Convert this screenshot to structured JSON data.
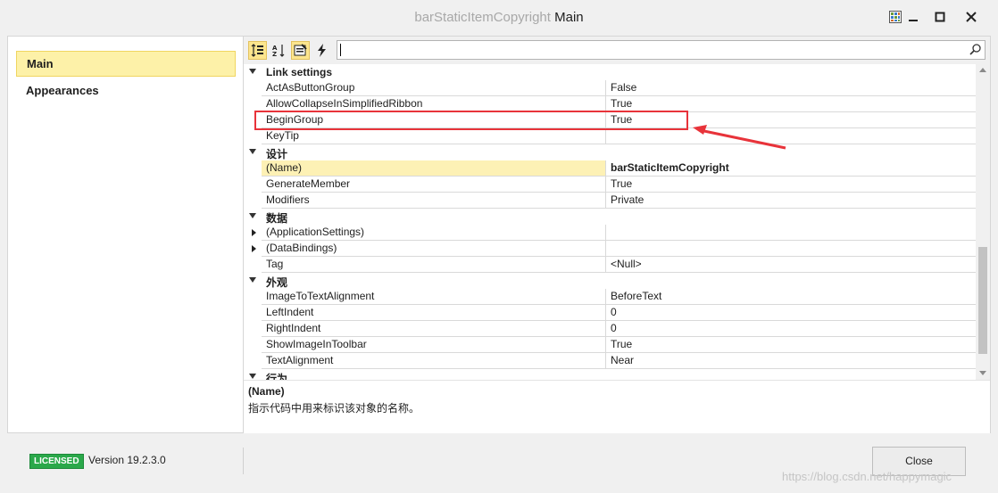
{
  "window": {
    "title_dim": "barStaticItemCopyright",
    "title_active": "Main"
  },
  "sidebar": {
    "items": [
      {
        "label": "Main",
        "selected": true
      },
      {
        "label": "Appearances",
        "selected": false
      }
    ]
  },
  "search": {
    "value": "",
    "placeholder": ""
  },
  "grid": {
    "categories": [
      {
        "name": "Link settings",
        "props": [
          {
            "name": "ActAsButtonGroup",
            "value": "False"
          },
          {
            "name": "AllowCollapseInSimplifiedRibbon",
            "value": "True"
          },
          {
            "name": "BeginGroup",
            "value": "True"
          },
          {
            "name": "KeyTip",
            "value": ""
          }
        ]
      },
      {
        "name": "设计",
        "props": [
          {
            "name": "(Name)",
            "value": "barStaticItemCopyright"
          },
          {
            "name": "GenerateMember",
            "value": "True"
          },
          {
            "name": "Modifiers",
            "value": "Private"
          }
        ]
      },
      {
        "name": "数据",
        "props": [
          {
            "name": "(ApplicationSettings)",
            "value": ""
          },
          {
            "name": "(DataBindings)",
            "value": ""
          },
          {
            "name": "Tag",
            "value": "<Null>"
          }
        ]
      },
      {
        "name": "外观",
        "props": [
          {
            "name": "ImageToTextAlignment",
            "value": "BeforeText"
          },
          {
            "name": "LeftIndent",
            "value": "0"
          },
          {
            "name": "RightIndent",
            "value": "0"
          },
          {
            "name": "ShowImageInToolbar",
            "value": "True"
          },
          {
            "name": "TextAlignment",
            "value": "Near"
          }
        ]
      },
      {
        "name": "行为",
        "props": []
      }
    ]
  },
  "description": {
    "title": "(Name)",
    "text": "指示代码中用来标识该对象的名称。"
  },
  "footer": {
    "badge": "LICENSED",
    "version": "Version 19.2.3.0",
    "close_label": "Close",
    "watermark": "https://blog.csdn.net/happymagic"
  },
  "colors": {
    "selection": "#fdf1a8",
    "highlight_box": "#e8333a",
    "badge": "#2aa84a"
  },
  "icons": [
    "grid-icon",
    "minimize-icon",
    "maximize-icon",
    "close-icon",
    "categorized-icon",
    "alphabetical-icon",
    "properties-icon",
    "events-icon",
    "search-icon",
    "expand-arrow-icon",
    "collapse-arrow-icon"
  ]
}
